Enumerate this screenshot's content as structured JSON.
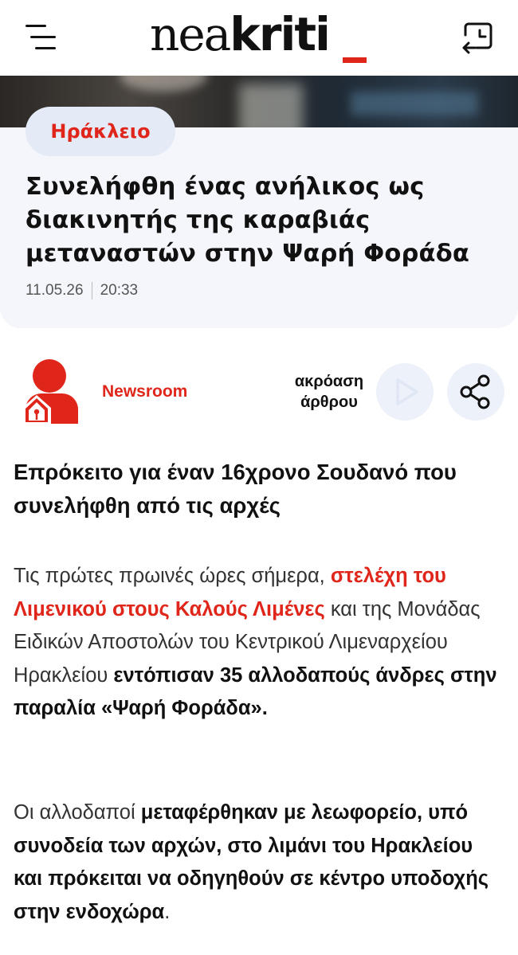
{
  "header": {
    "logo_light": "nea",
    "logo_bold": "kriti",
    "logo_accent": "#e0261a",
    "menu_icon": "hamburger-icon",
    "history_icon": "history-icon"
  },
  "article": {
    "category": "Ηράκλειο",
    "headline": "Συνελήφθη ένας ανήλικος ως διακινητής της καραβιάς μεταναστών στην Ψαρή Φοράδα",
    "date": "11.05.26",
    "time": "20:33",
    "author": "Newsroom",
    "listen_label": "ακρόαση άρθρου",
    "lead": "Επρόκειτο για έναν 16χρονο Σουδανό που συνελήφθη από τις αρχές",
    "p1": {
      "a": "Τις πρώτες πρωινές ώρες σήμερα, ",
      "link": "στελέχη του Λιμενικού στους Καλούς Λιμένες",
      "b": " και της Μονάδας Ειδικών Αποστολών του Κεντρικού Λιμεναρχείου Ηρακλείου ",
      "strong": "εντόπισαν 35 αλλοδαπούς άνδρες στην παραλία «Ψαρή Φοράδα»."
    },
    "p2": {
      "a": "Οι αλλοδαποί ",
      "strong": "μεταφέρθηκαν με λεωφορείο, υπό συνοδεία των αρχών, στο λιμάνι του Ηρακλείου και πρόκειται να οδηγηθούν σε κέντρο υποδοχής στην ενδοχώρα",
      "b": "."
    }
  }
}
